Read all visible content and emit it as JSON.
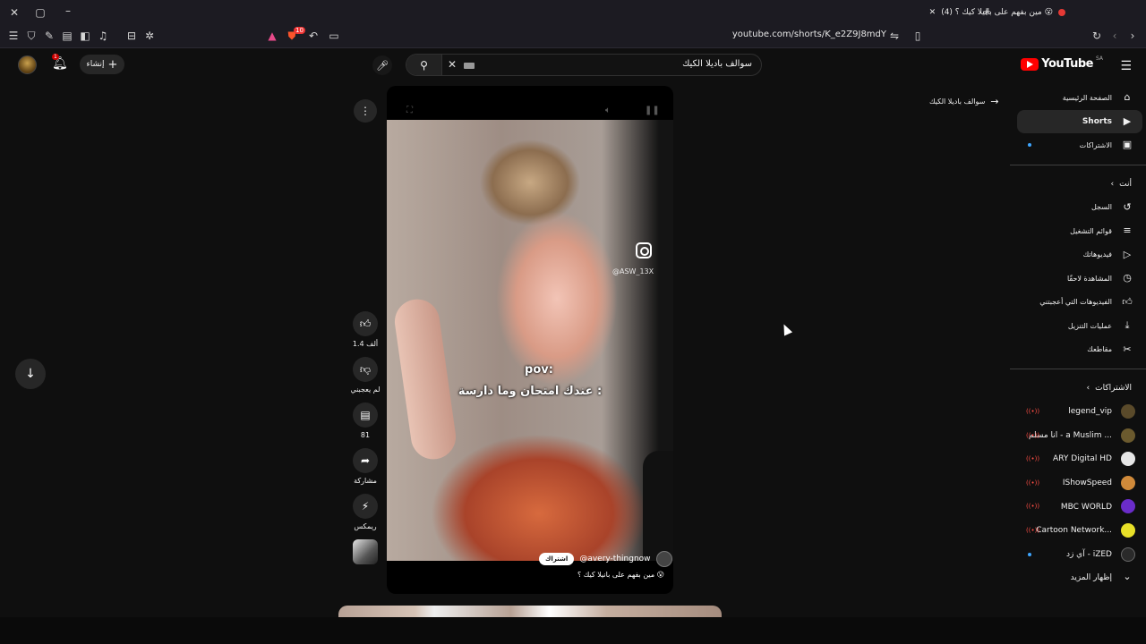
{
  "browser": {
    "tab_title": "(4) مين بفهم على بانيلا كيك ؟ 😮",
    "url": "youtube.com/shorts/K_e2Z9J8mdY",
    "extension_badge": "10"
  },
  "header": {
    "logo_text": "YouTube",
    "country": "SA",
    "search_query": "سوالف باديلا الكيك",
    "create_label": "إنشاء",
    "notifications_count": "1"
  },
  "guide": {
    "main": [
      {
        "label": "الصفحة الرئيسية",
        "icon": "home-icon"
      },
      {
        "label": "Shorts",
        "icon": "shorts-icon",
        "active": true
      },
      {
        "label": "الاشتراكات",
        "icon": "subscriptions-icon",
        "dot": true
      }
    ],
    "you_header": "أنت",
    "you": [
      {
        "label": "السجل",
        "icon": "history-icon"
      },
      {
        "label": "قوائم التشغيل",
        "icon": "playlists-icon"
      },
      {
        "label": "فيديوهاتك",
        "icon": "your-videos-icon"
      },
      {
        "label": "المشاهدة لاحقًا",
        "icon": "watch-later-icon"
      },
      {
        "label": "الفيديوهات التي أعجبتني",
        "icon": "liked-icon"
      },
      {
        "label": "عمليات التنزيل",
        "icon": "download-icon"
      },
      {
        "label": "مقاطعك",
        "icon": "clips-icon"
      }
    ],
    "subs_header": "الاشتراكات",
    "subscriptions": [
      {
        "name": "legend_vip",
        "color": "#5a4a2a",
        "live": true
      },
      {
        "name": "انا مسلم - a Muslim ...",
        "color": "#6b5a2e",
        "live": true
      },
      {
        "name": "ARY Digital HD",
        "color": "#e6e6e6",
        "live": true
      },
      {
        "name": "IShowSpeed",
        "color": "#d08a3a",
        "live": true
      },
      {
        "name": "MBC WORLD",
        "color": "#6a2cc9",
        "live": true
      },
      {
        "name": "Cartoon Network...",
        "color": "#e8e028",
        "live": true
      },
      {
        "name": "آي زد - iZED",
        "color": "#2a2a2a",
        "dot": true
      }
    ],
    "show_more": "إظهار المزيد"
  },
  "shorts": {
    "breadcrumb": "سوالف باديلا الكيك",
    "overlay_line1": "pov:",
    "overlay_line2": "عندك امتحان وما دارسة :",
    "watermark": "@ASW_13X",
    "channel": "@avery-thingnow",
    "subscribe_label": "اشتراك",
    "caption": "مين بفهم على بانيلا كيك ؟ 😮",
    "likes": "1.4 ألف",
    "dislike_label": "لم يعجبني",
    "comments": "81",
    "share_label": "مشاركة",
    "remix_label": "ريمكس"
  }
}
